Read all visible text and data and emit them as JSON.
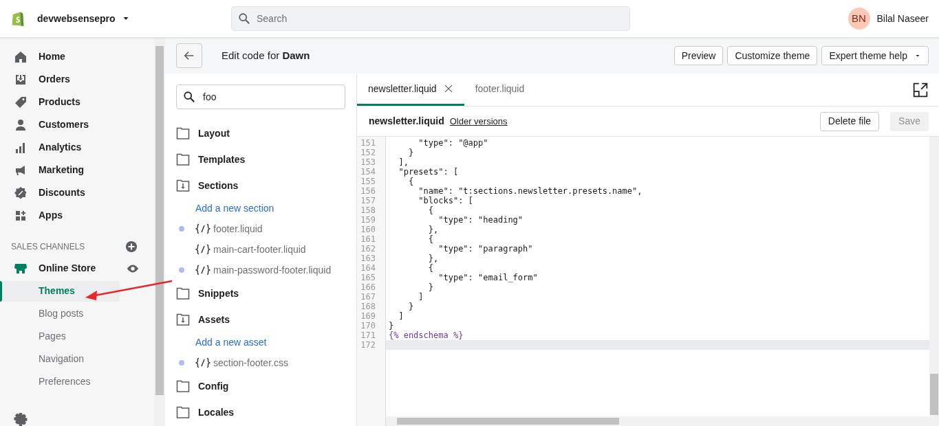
{
  "topbar": {
    "store_name": "devwebsensepro",
    "search": {
      "placeholder": "Search"
    },
    "user": {
      "initials": "BN",
      "name": "Bilal Naseer"
    }
  },
  "sidebar": {
    "items": [
      {
        "label": "Home",
        "selected": false
      },
      {
        "label": "Orders",
        "selected": false
      },
      {
        "label": "Products",
        "selected": false
      },
      {
        "label": "Customers",
        "selected": false
      },
      {
        "label": "Analytics",
        "selected": false
      },
      {
        "label": "Marketing",
        "selected": false
      },
      {
        "label": "Discounts",
        "selected": false
      },
      {
        "label": "Apps",
        "selected": false
      }
    ],
    "channels_heading": "SALES CHANNELS",
    "channel": {
      "label": "Online Store",
      "selected": false,
      "children": [
        {
          "label": "Themes",
          "selected": true
        },
        {
          "label": "Blog posts",
          "selected": false
        },
        {
          "label": "Pages",
          "selected": false
        },
        {
          "label": "Navigation",
          "selected": false
        },
        {
          "label": "Preferences",
          "selected": false
        }
      ]
    }
  },
  "header": {
    "title_prefix": "Edit code for ",
    "theme_name": "Dawn",
    "buttons": [
      "Preview",
      "Customize theme",
      "Expert theme help"
    ]
  },
  "file_tree": {
    "search": {
      "value": "foo"
    },
    "folders": [
      {
        "label": "Layout",
        "expanded": false
      },
      {
        "label": "Templates",
        "expanded": false
      },
      {
        "label": "Sections",
        "expanded": true,
        "children": [
          {
            "kind": "link",
            "label": "Add a new section"
          },
          {
            "kind": "file",
            "label": "footer.liquid",
            "modified": true
          },
          {
            "kind": "file",
            "label": "main-cart-footer.liquid",
            "modified": false
          },
          {
            "kind": "file",
            "label": "main-password-footer.liquid",
            "modified": true
          }
        ]
      },
      {
        "label": "Snippets",
        "expanded": false
      },
      {
        "label": "Assets",
        "expanded": true,
        "children": [
          {
            "kind": "link",
            "label": "Add a new asset"
          },
          {
            "kind": "file",
            "label": "section-footer.css",
            "modified": true
          }
        ]
      },
      {
        "label": "Config",
        "expanded": false
      },
      {
        "label": "Locales",
        "expanded": false
      }
    ]
  },
  "editor": {
    "tabs": [
      {
        "label": "newsletter.liquid",
        "selected": true
      },
      {
        "label": "footer.liquid",
        "selected": false
      }
    ],
    "file_name": "newsletter.liquid",
    "older_versions": "Older versions",
    "delete_button": "Delete file",
    "save_button": {
      "label": "Save",
      "disabled": true
    },
    "lines": [
      {
        "number": "151",
        "text": "      \"type\": \"@app\"",
        "current": false
      },
      {
        "number": "152",
        "text": "    }",
        "current": false
      },
      {
        "number": "153",
        "text": "  ],",
        "current": false
      },
      {
        "number": "154",
        "text": "  \"presets\": [",
        "current": false
      },
      {
        "number": "155",
        "text": "    {",
        "current": false
      },
      {
        "number": "156",
        "text": "      \"name\": \"t:sections.newsletter.presets.name\",",
        "current": false
      },
      {
        "number": "157",
        "text": "      \"blocks\": [",
        "current": false
      },
      {
        "number": "158",
        "text": "        {",
        "current": false
      },
      {
        "number": "159",
        "text": "          \"type\": \"heading\"",
        "current": false
      },
      {
        "number": "160",
        "text": "        },",
        "current": false
      },
      {
        "number": "161",
        "text": "        {",
        "current": false
      },
      {
        "number": "162",
        "text": "          \"type\": \"paragraph\"",
        "current": false
      },
      {
        "number": "163",
        "text": "        },",
        "current": false
      },
      {
        "number": "164",
        "text": "        {",
        "current": false
      },
      {
        "number": "165",
        "text": "          \"type\": \"email_form\"",
        "current": false
      },
      {
        "number": "166",
        "text": "        }",
        "current": false
      },
      {
        "number": "167",
        "text": "      ]",
        "current": false
      },
      {
        "number": "168",
        "text": "    }",
        "current": false
      },
      {
        "number": "169",
        "text": "  ]",
        "current": false
      },
      {
        "number": "170",
        "text": "}",
        "current": false
      },
      {
        "number": "171",
        "text": "{% endschema %}",
        "current": false
      },
      {
        "number": "172",
        "current": true
      }
    ]
  }
}
